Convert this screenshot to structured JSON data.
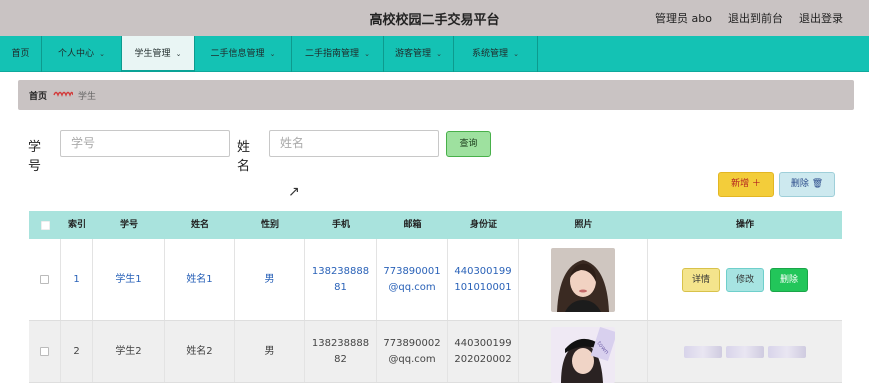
{
  "header": {
    "title": "高校校园二手交易平台",
    "admin": "管理员 abo",
    "to_front": "退出到前台",
    "logout": "退出登录"
  },
  "nav": {
    "items": [
      {
        "label": "首页",
        "dropdown": false
      },
      {
        "label": "个人中心",
        "dropdown": true
      },
      {
        "label": "学生管理",
        "dropdown": true,
        "active": true
      },
      {
        "label": "二手信息管理",
        "dropdown": true
      },
      {
        "label": "二手指南管理",
        "dropdown": true
      },
      {
        "label": "游客管理",
        "dropdown": true
      },
      {
        "label": "系统管理",
        "dropdown": true
      }
    ]
  },
  "breadcrumb": {
    "home": "首页",
    "current": "学生"
  },
  "search": {
    "student_id_label": "学号",
    "student_id_placeholder": "学号",
    "name_label": "姓名",
    "name_placeholder": "姓名",
    "query_button": "查询"
  },
  "actions": {
    "add_label": "新增 ＋",
    "delete_label": "删除 🗑"
  },
  "table": {
    "columns": [
      "索引",
      "学号",
      "姓名",
      "性别",
      "手机",
      "邮箱",
      "身份证",
      "照片",
      "操作"
    ],
    "rows": [
      {
        "index": "1",
        "student_id": "学生1",
        "name": "姓名1",
        "gender": "男",
        "phone": "13823888881",
        "email": "773890001@qq.com",
        "id_card": "440300199101010001"
      },
      {
        "index": "2",
        "student_id": "学生2",
        "name": "姓名2",
        "gender": "男",
        "phone": "13823888882",
        "email": "773890002@qq.com",
        "id_card": "440300199202020002"
      }
    ],
    "row_actions": {
      "detail": "详情",
      "edit": "修改",
      "delete": "删除"
    }
  },
  "colors": {
    "topbar": "#c9c3c3",
    "nav": "#14c2b4",
    "table_header": "#a9e3dd",
    "add_button": "#f3cd3a",
    "query_button": "#9ee19f",
    "delete_row_button": "#22c65a"
  }
}
